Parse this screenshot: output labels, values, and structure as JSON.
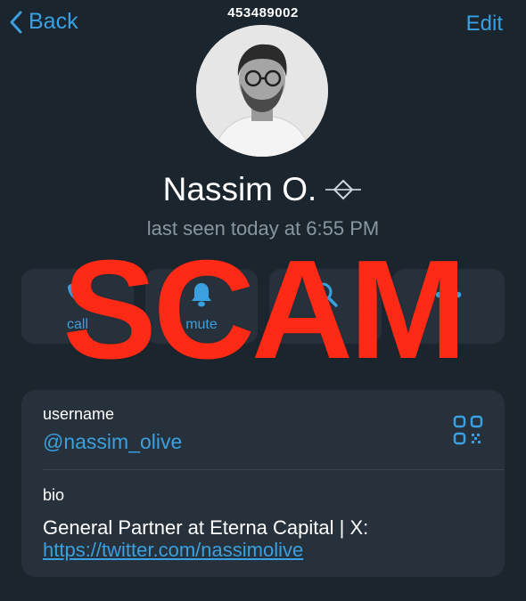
{
  "header": {
    "id_label": "453489002",
    "back_label": "Back",
    "edit_label": "Edit"
  },
  "profile": {
    "name": "Nassim O.",
    "status": "last seen today at 6:55 PM"
  },
  "actions": [
    {
      "label": "call",
      "icon": "phone-icon"
    },
    {
      "label": "mute",
      "icon": "bell-icon"
    },
    {
      "label": "rch",
      "icon": "search-icon"
    },
    {
      "label": "re",
      "icon": "more-icon"
    }
  ],
  "info": {
    "username_label": "username",
    "username_value": "@nassim_olive",
    "bio_label": "bio",
    "bio_text": "General Partner at Eterna Capital | X:",
    "bio_link": "https://twitter.com/nassimolive"
  },
  "overlay": {
    "text": "SCAM",
    "color": "#ff2a16"
  },
  "colors": {
    "background": "#1b252e",
    "card": "#26313b",
    "accent": "#3aa0e0"
  }
}
